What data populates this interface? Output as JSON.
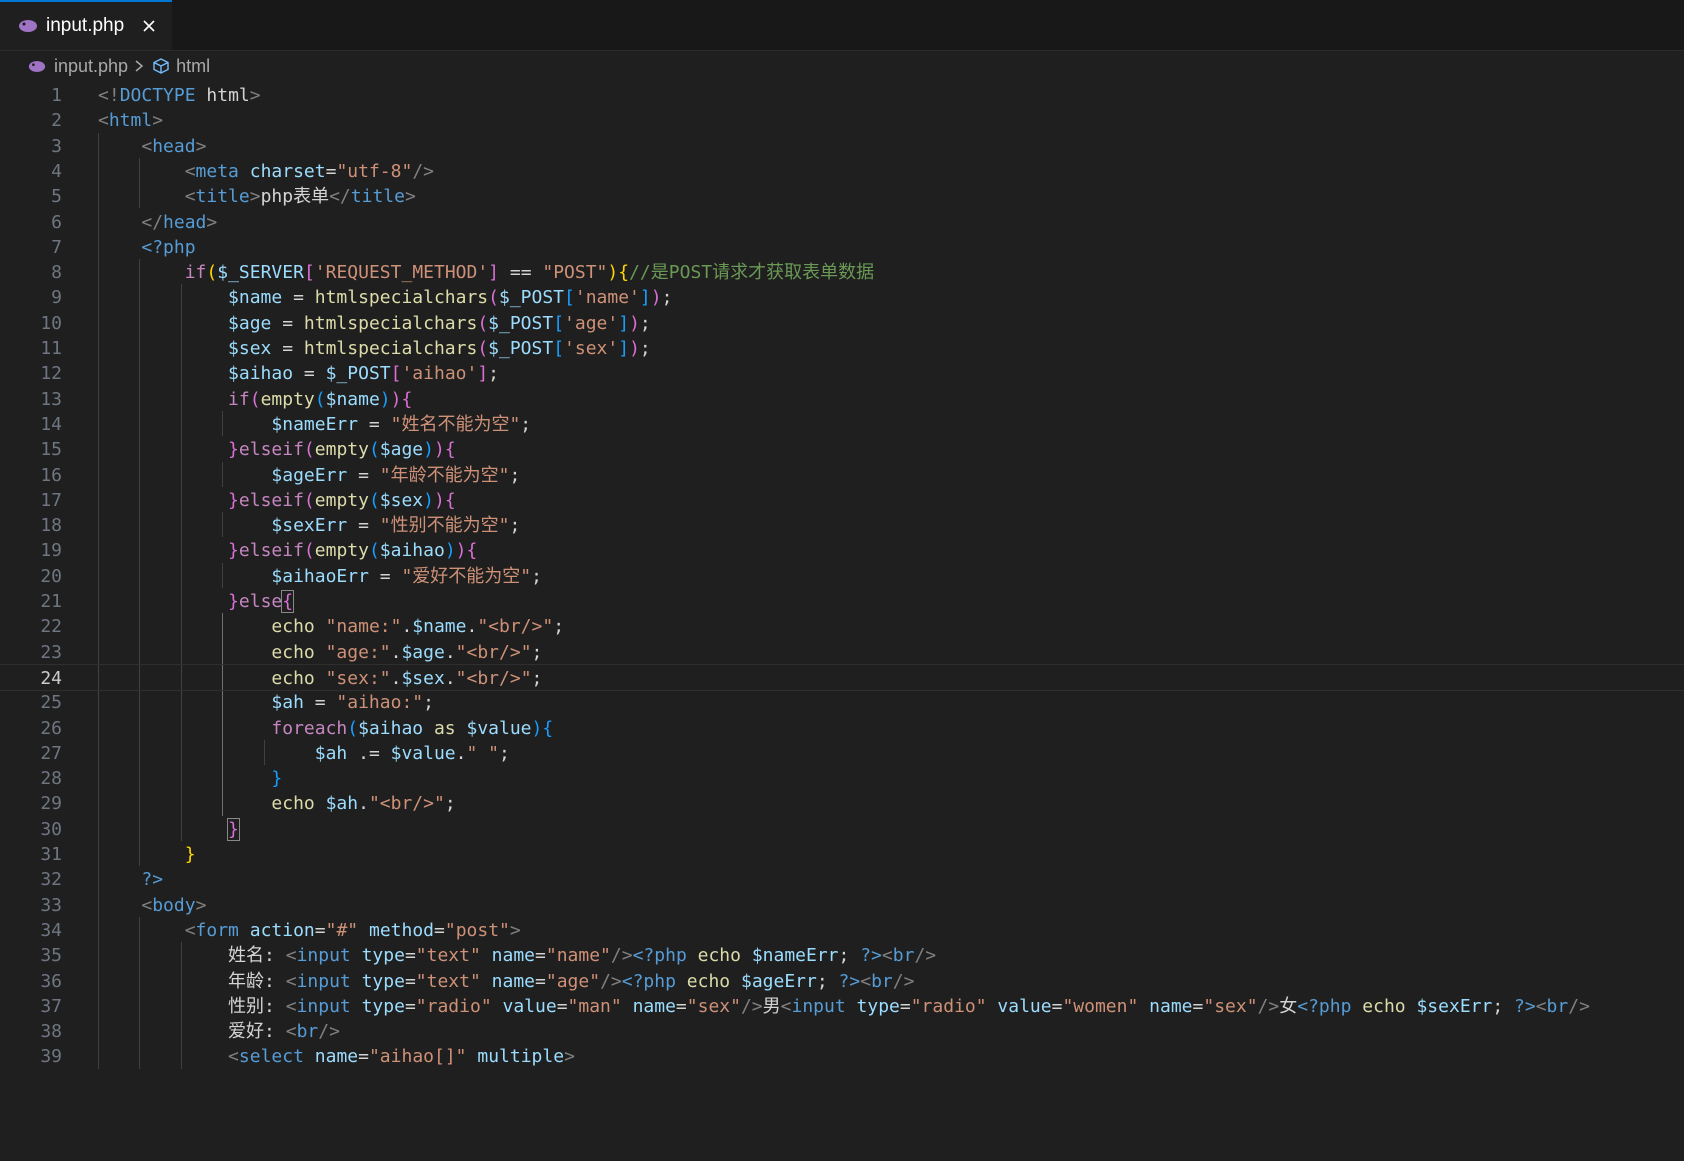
{
  "tab": {
    "label": "input.php"
  },
  "breadcrumb": {
    "file": "input.php",
    "symbol": "html"
  },
  "editor": {
    "current_line": 24,
    "lines": [
      [
        [
          "t-p",
          "<!"
        ],
        [
          "t-doc",
          "DOCTYPE "
        ],
        [
          "t-w",
          "html"
        ],
        [
          "t-p",
          ">"
        ]
      ],
      [
        [
          "t-p",
          "<"
        ],
        [
          "t-tg",
          "html"
        ],
        [
          "t-p",
          ">"
        ]
      ],
      [
        [
          "t-w",
          "    "
        ],
        [
          "t-p",
          "<"
        ],
        [
          "t-tg",
          "head"
        ],
        [
          "t-p",
          ">"
        ]
      ],
      [
        [
          "t-w",
          "        "
        ],
        [
          "t-p",
          "<"
        ],
        [
          "t-tg",
          "meta"
        ],
        [
          "t-w",
          " "
        ],
        [
          "t-at",
          "charset"
        ],
        [
          "t-w",
          "="
        ],
        [
          "t-s",
          "\"utf-8\""
        ],
        [
          "t-p",
          "/>"
        ]
      ],
      [
        [
          "t-w",
          "        "
        ],
        [
          "t-p",
          "<"
        ],
        [
          "t-tg",
          "title"
        ],
        [
          "t-p",
          ">"
        ],
        [
          "t-w",
          "php表单"
        ],
        [
          "t-p",
          "</"
        ],
        [
          "t-tg",
          "title"
        ],
        [
          "t-p",
          ">"
        ]
      ],
      [
        [
          "t-w",
          "    "
        ],
        [
          "t-p",
          "</"
        ],
        [
          "t-tg",
          "head"
        ],
        [
          "t-p",
          ">"
        ]
      ],
      [
        [
          "t-w",
          "    "
        ],
        [
          "t-tg",
          "<?php"
        ]
      ],
      [
        [
          "t-w",
          "        "
        ],
        [
          "t-k",
          "if"
        ],
        [
          "t-b1",
          "("
        ],
        [
          "t-at",
          "$_SERVER"
        ],
        [
          "t-b2",
          "["
        ],
        [
          "t-s",
          "'REQUEST_METHOD'"
        ],
        [
          "t-b2",
          "]"
        ],
        [
          "t-w",
          " == "
        ],
        [
          "t-s",
          "\"POST\""
        ],
        [
          "t-b1",
          ")"
        ],
        [
          "t-b1",
          "{"
        ],
        [
          "t-c",
          "//是POST请求才获取表单数据"
        ]
      ],
      [
        [
          "t-w",
          "            "
        ],
        [
          "t-at",
          "$name"
        ],
        [
          "t-w",
          " = "
        ],
        [
          "t-f",
          "htmlspecialchars"
        ],
        [
          "t-b2",
          "("
        ],
        [
          "t-at",
          "$_POST"
        ],
        [
          "t-b3",
          "["
        ],
        [
          "t-s",
          "'name'"
        ],
        [
          "t-b3",
          "]"
        ],
        [
          "t-b2",
          ")"
        ],
        [
          "t-w",
          ";"
        ]
      ],
      [
        [
          "t-w",
          "            "
        ],
        [
          "t-at",
          "$age"
        ],
        [
          "t-w",
          " = "
        ],
        [
          "t-f",
          "htmlspecialchars"
        ],
        [
          "t-b2",
          "("
        ],
        [
          "t-at",
          "$_POST"
        ],
        [
          "t-b3",
          "["
        ],
        [
          "t-s",
          "'age'"
        ],
        [
          "t-b3",
          "]"
        ],
        [
          "t-b2",
          ")"
        ],
        [
          "t-w",
          ";"
        ]
      ],
      [
        [
          "t-w",
          "            "
        ],
        [
          "t-at",
          "$sex"
        ],
        [
          "t-w",
          " = "
        ],
        [
          "t-f",
          "htmlspecialchars"
        ],
        [
          "t-b2",
          "("
        ],
        [
          "t-at",
          "$_POST"
        ],
        [
          "t-b3",
          "["
        ],
        [
          "t-s",
          "'sex'"
        ],
        [
          "t-b3",
          "]"
        ],
        [
          "t-b2",
          ")"
        ],
        [
          "t-w",
          ";"
        ]
      ],
      [
        [
          "t-w",
          "            "
        ],
        [
          "t-at",
          "$aihao"
        ],
        [
          "t-w",
          " = "
        ],
        [
          "t-at",
          "$_POST"
        ],
        [
          "t-b2",
          "["
        ],
        [
          "t-s",
          "'aihao'"
        ],
        [
          "t-b2",
          "]"
        ],
        [
          "t-w",
          ";"
        ]
      ],
      [
        [
          "t-w",
          "            "
        ],
        [
          "t-k",
          "if"
        ],
        [
          "t-b2",
          "("
        ],
        [
          "t-f",
          "empty"
        ],
        [
          "t-b3",
          "("
        ],
        [
          "t-at",
          "$name"
        ],
        [
          "t-b3",
          ")"
        ],
        [
          "t-b2",
          ")"
        ],
        [
          "t-b2",
          "{"
        ]
      ],
      [
        [
          "t-w",
          "                "
        ],
        [
          "t-at",
          "$nameErr"
        ],
        [
          "t-w",
          " = "
        ],
        [
          "t-s",
          "\"姓名不能为空\""
        ],
        [
          "t-w",
          ";"
        ]
      ],
      [
        [
          "t-w",
          "            "
        ],
        [
          "t-b2",
          "}"
        ],
        [
          "t-k",
          "elseif"
        ],
        [
          "t-b2",
          "("
        ],
        [
          "t-f",
          "empty"
        ],
        [
          "t-b3",
          "("
        ],
        [
          "t-at",
          "$age"
        ],
        [
          "t-b3",
          ")"
        ],
        [
          "t-b2",
          ")"
        ],
        [
          "t-b2",
          "{"
        ]
      ],
      [
        [
          "t-w",
          "                "
        ],
        [
          "t-at",
          "$ageErr"
        ],
        [
          "t-w",
          " = "
        ],
        [
          "t-s",
          "\"年龄不能为空\""
        ],
        [
          "t-w",
          ";"
        ]
      ],
      [
        [
          "t-w",
          "            "
        ],
        [
          "t-b2",
          "}"
        ],
        [
          "t-k",
          "elseif"
        ],
        [
          "t-b2",
          "("
        ],
        [
          "t-f",
          "empty"
        ],
        [
          "t-b3",
          "("
        ],
        [
          "t-at",
          "$sex"
        ],
        [
          "t-b3",
          ")"
        ],
        [
          "t-b2",
          ")"
        ],
        [
          "t-b2",
          "{"
        ]
      ],
      [
        [
          "t-w",
          "                "
        ],
        [
          "t-at",
          "$sexErr"
        ],
        [
          "t-w",
          " = "
        ],
        [
          "t-s",
          "\"性别不能为空\""
        ],
        [
          "t-w",
          ";"
        ]
      ],
      [
        [
          "t-w",
          "            "
        ],
        [
          "t-b2",
          "}"
        ],
        [
          "t-k",
          "elseif"
        ],
        [
          "t-b2",
          "("
        ],
        [
          "t-f",
          "empty"
        ],
        [
          "t-b3",
          "("
        ],
        [
          "t-at",
          "$aihao"
        ],
        [
          "t-b3",
          ")"
        ],
        [
          "t-b2",
          ")"
        ],
        [
          "t-b2",
          "{"
        ]
      ],
      [
        [
          "t-w",
          "                "
        ],
        [
          "t-at",
          "$aihaoErr"
        ],
        [
          "t-w",
          " = "
        ],
        [
          "t-s",
          "\"爱好不能为空\""
        ],
        [
          "t-w",
          ";"
        ]
      ],
      [
        [
          "t-w",
          "            "
        ],
        [
          "t-b2",
          "}"
        ],
        [
          "t-k",
          "else"
        ],
        [
          "t-b2 t-bm",
          "{"
        ]
      ],
      [
        [
          "t-w",
          "                "
        ],
        [
          "t-f",
          "echo"
        ],
        [
          "t-w",
          " "
        ],
        [
          "t-s",
          "\"name:\""
        ],
        [
          "t-w",
          "."
        ],
        [
          "t-at",
          "$name"
        ],
        [
          "t-w",
          "."
        ],
        [
          "t-s",
          "\"<br/>\""
        ],
        [
          "t-w",
          ";"
        ]
      ],
      [
        [
          "t-w",
          "                "
        ],
        [
          "t-f",
          "echo"
        ],
        [
          "t-w",
          " "
        ],
        [
          "t-s",
          "\"age:\""
        ],
        [
          "t-w",
          "."
        ],
        [
          "t-at",
          "$age"
        ],
        [
          "t-w",
          "."
        ],
        [
          "t-s",
          "\"<br/>\""
        ],
        [
          "t-w",
          ";"
        ]
      ],
      [
        [
          "t-w",
          "                "
        ],
        [
          "t-f",
          "echo"
        ],
        [
          "t-w",
          " "
        ],
        [
          "t-s",
          "\"sex:\""
        ],
        [
          "t-w",
          "."
        ],
        [
          "t-at",
          "$sex"
        ],
        [
          "t-w",
          "."
        ],
        [
          "t-s",
          "\"<br/>\""
        ],
        [
          "t-w",
          ";"
        ]
      ],
      [
        [
          "t-w",
          "                "
        ],
        [
          "t-at",
          "$ah"
        ],
        [
          "t-w",
          " = "
        ],
        [
          "t-s",
          "\"aihao:\""
        ],
        [
          "t-w",
          ";"
        ]
      ],
      [
        [
          "t-w",
          "                "
        ],
        [
          "t-k",
          "foreach"
        ],
        [
          "t-b3",
          "("
        ],
        [
          "t-at",
          "$aihao"
        ],
        [
          "t-w",
          " "
        ],
        [
          "t-f",
          "as"
        ],
        [
          "t-w",
          " "
        ],
        [
          "t-at",
          "$value"
        ],
        [
          "t-b3",
          ")"
        ],
        [
          "t-b3",
          "{"
        ]
      ],
      [
        [
          "t-w",
          "                    "
        ],
        [
          "t-at",
          "$ah"
        ],
        [
          "t-w",
          " .= "
        ],
        [
          "t-at",
          "$value"
        ],
        [
          "t-w",
          "."
        ],
        [
          "t-s",
          "\" \""
        ],
        [
          "t-w",
          ";"
        ]
      ],
      [
        [
          "t-w",
          "                "
        ],
        [
          "t-b3",
          "}"
        ]
      ],
      [
        [
          "t-w",
          "                "
        ],
        [
          "t-f",
          "echo"
        ],
        [
          "t-w",
          " "
        ],
        [
          "t-at",
          "$ah"
        ],
        [
          "t-w",
          "."
        ],
        [
          "t-s",
          "\"<br/>\""
        ],
        [
          "t-w",
          ";"
        ]
      ],
      [
        [
          "t-w",
          "            "
        ],
        [
          "t-b2 t-bm",
          "}"
        ]
      ],
      [
        [
          "t-w",
          "        "
        ],
        [
          "t-b1",
          "}"
        ]
      ],
      [
        [
          "t-w",
          "    "
        ],
        [
          "t-tg",
          "?>"
        ]
      ],
      [
        [
          "t-w",
          "    "
        ],
        [
          "t-p",
          "<"
        ],
        [
          "t-tg",
          "body"
        ],
        [
          "t-p",
          ">"
        ]
      ],
      [
        [
          "t-w",
          "        "
        ],
        [
          "t-p",
          "<"
        ],
        [
          "t-tg",
          "form"
        ],
        [
          "t-w",
          " "
        ],
        [
          "t-at",
          "action"
        ],
        [
          "t-w",
          "="
        ],
        [
          "t-s",
          "\"#\""
        ],
        [
          "t-w",
          " "
        ],
        [
          "t-at",
          "method"
        ],
        [
          "t-w",
          "="
        ],
        [
          "t-s",
          "\"post\""
        ],
        [
          "t-p",
          ">"
        ]
      ],
      [
        [
          "t-w",
          "            姓名: "
        ],
        [
          "t-p",
          "<"
        ],
        [
          "t-tg",
          "input"
        ],
        [
          "t-w",
          " "
        ],
        [
          "t-at",
          "type"
        ],
        [
          "t-w",
          "="
        ],
        [
          "t-s",
          "\"text\""
        ],
        [
          "t-w",
          " "
        ],
        [
          "t-at",
          "name"
        ],
        [
          "t-w",
          "="
        ],
        [
          "t-s",
          "\"name\""
        ],
        [
          "t-p",
          "/>"
        ],
        [
          "t-tg",
          "<?php"
        ],
        [
          "t-w",
          " "
        ],
        [
          "t-f",
          "echo"
        ],
        [
          "t-w",
          " "
        ],
        [
          "t-at",
          "$nameErr"
        ],
        [
          "t-w",
          "; "
        ],
        [
          "t-tg",
          "?>"
        ],
        [
          "t-p",
          "<"
        ],
        [
          "t-tg",
          "br"
        ],
        [
          "t-p",
          "/>"
        ]
      ],
      [
        [
          "t-w",
          "            年龄: "
        ],
        [
          "t-p",
          "<"
        ],
        [
          "t-tg",
          "input"
        ],
        [
          "t-w",
          " "
        ],
        [
          "t-at",
          "type"
        ],
        [
          "t-w",
          "="
        ],
        [
          "t-s",
          "\"text\""
        ],
        [
          "t-w",
          " "
        ],
        [
          "t-at",
          "name"
        ],
        [
          "t-w",
          "="
        ],
        [
          "t-s",
          "\"age\""
        ],
        [
          "t-p",
          "/>"
        ],
        [
          "t-tg",
          "<?php"
        ],
        [
          "t-w",
          " "
        ],
        [
          "t-f",
          "echo"
        ],
        [
          "t-w",
          " "
        ],
        [
          "t-at",
          "$ageErr"
        ],
        [
          "t-w",
          "; "
        ],
        [
          "t-tg",
          "?>"
        ],
        [
          "t-p",
          "<"
        ],
        [
          "t-tg",
          "br"
        ],
        [
          "t-p",
          "/>"
        ]
      ],
      [
        [
          "t-w",
          "            性别: "
        ],
        [
          "t-p",
          "<"
        ],
        [
          "t-tg",
          "input"
        ],
        [
          "t-w",
          " "
        ],
        [
          "t-at",
          "type"
        ],
        [
          "t-w",
          "="
        ],
        [
          "t-s",
          "\"radio\""
        ],
        [
          "t-w",
          " "
        ],
        [
          "t-at",
          "value"
        ],
        [
          "t-w",
          "="
        ],
        [
          "t-s",
          "\"man\""
        ],
        [
          "t-w",
          " "
        ],
        [
          "t-at",
          "name"
        ],
        [
          "t-w",
          "="
        ],
        [
          "t-s",
          "\"sex\""
        ],
        [
          "t-p",
          "/>"
        ],
        [
          "t-w",
          "男"
        ],
        [
          "t-p",
          "<"
        ],
        [
          "t-tg",
          "input"
        ],
        [
          "t-w",
          " "
        ],
        [
          "t-at",
          "type"
        ],
        [
          "t-w",
          "="
        ],
        [
          "t-s",
          "\"radio\""
        ],
        [
          "t-w",
          " "
        ],
        [
          "t-at",
          "value"
        ],
        [
          "t-w",
          "="
        ],
        [
          "t-s",
          "\"women\""
        ],
        [
          "t-w",
          " "
        ],
        [
          "t-at",
          "name"
        ],
        [
          "t-w",
          "="
        ],
        [
          "t-s",
          "\"sex\""
        ],
        [
          "t-p",
          "/>"
        ],
        [
          "t-w",
          "女"
        ],
        [
          "t-tg",
          "<?php"
        ],
        [
          "t-w",
          " "
        ],
        [
          "t-f",
          "echo"
        ],
        [
          "t-w",
          " "
        ],
        [
          "t-at",
          "$sexErr"
        ],
        [
          "t-w",
          "; "
        ],
        [
          "t-tg",
          "?>"
        ],
        [
          "t-p",
          "<"
        ],
        [
          "t-tg",
          "br"
        ],
        [
          "t-p",
          "/>"
        ]
      ],
      [
        [
          "t-w",
          "            爱好: "
        ],
        [
          "t-p",
          "<"
        ],
        [
          "t-tg",
          "br"
        ],
        [
          "t-p",
          "/>"
        ]
      ],
      [
        [
          "t-w",
          "            "
        ],
        [
          "t-p",
          "<"
        ],
        [
          "t-tg",
          "select"
        ],
        [
          "t-w",
          " "
        ],
        [
          "t-at",
          "name"
        ],
        [
          "t-w",
          "="
        ],
        [
          "t-s",
          "\"aihao[]\""
        ],
        [
          "t-w",
          " "
        ],
        [
          "t-at",
          "multiple"
        ],
        [
          "t-p",
          ">"
        ]
      ]
    ]
  }
}
